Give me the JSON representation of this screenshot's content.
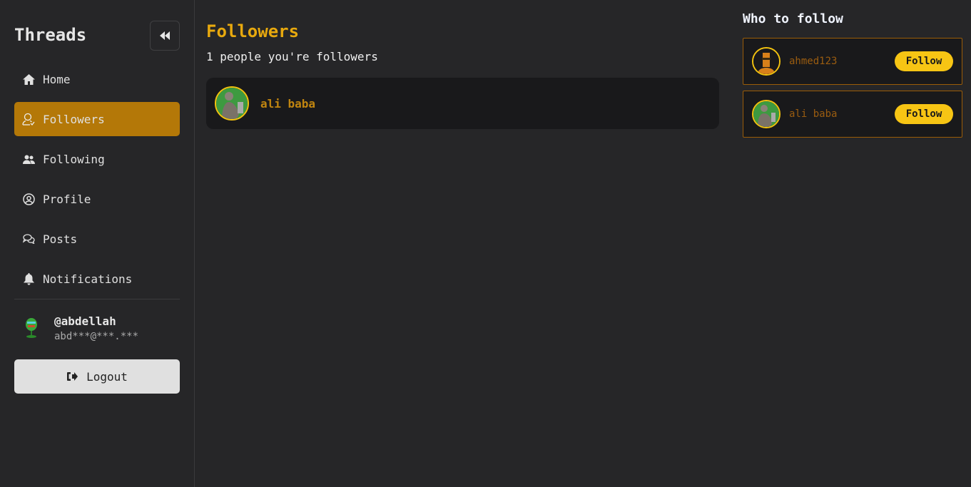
{
  "sidebar": {
    "brand": "Threads",
    "items": [
      {
        "label": "Home",
        "icon": "home-icon"
      },
      {
        "label": "Followers",
        "icon": "user-check-icon",
        "active": true
      },
      {
        "label": "Following",
        "icon": "users-icon"
      },
      {
        "label": "Profile",
        "icon": "user-circle-icon"
      },
      {
        "label": "Posts",
        "icon": "chat-bubbles-icon"
      },
      {
        "label": "Notifications",
        "icon": "bell-icon"
      }
    ],
    "user": {
      "handle": "@abdellah",
      "email": "abd***@***.***"
    },
    "logout_label": "Logout"
  },
  "main": {
    "title": "Followers",
    "subtitle": "1 people you're followers",
    "followers": [
      {
        "name": "ali baba"
      }
    ]
  },
  "who_to_follow": {
    "title": "Who to follow",
    "suggestions": [
      {
        "name": "ahmed123",
        "button": "Follow"
      },
      {
        "name": "ali baba",
        "button": "Follow"
      }
    ]
  },
  "colors": {
    "accent": "#b47808",
    "title": "#e8a90e",
    "follow_button": "#f7c514",
    "background": "#262628",
    "card": "#19191b"
  }
}
